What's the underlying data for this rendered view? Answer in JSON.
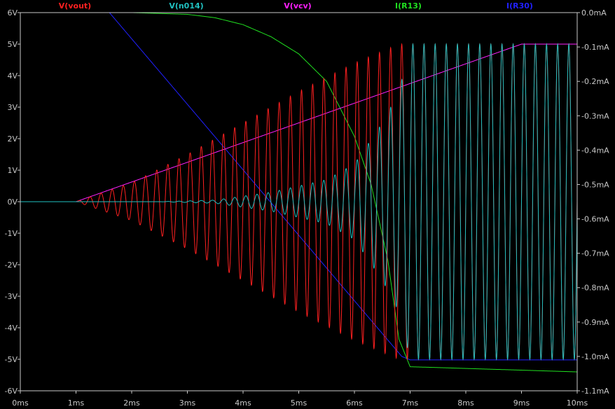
{
  "chart_data": {
    "type": "line",
    "title": "",
    "xlabel": "",
    "ylabel": "",
    "xlim": [
      0,
      10
    ],
    "ylim_left": [
      -6,
      6
    ],
    "ylim_right": [
      -1.1,
      0.0
    ],
    "grid": false,
    "legend_position": "top",
    "x_ticks": [
      "0ms",
      "1ms",
      "2ms",
      "3ms",
      "4ms",
      "5ms",
      "6ms",
      "7ms",
      "8ms",
      "9ms",
      "10ms"
    ],
    "y_ticks_left": [
      "6V",
      "5V",
      "4V",
      "3V",
      "2V",
      "1V",
      "0V",
      "-1V",
      "-2V",
      "-3V",
      "-4V",
      "-5V",
      "-6V"
    ],
    "y_ticks_right": [
      "0.0mA",
      "-0.1mA",
      "-0.2mA",
      "-0.3mA",
      "-0.4mA",
      "-0.5mA",
      "-0.6mA",
      "-0.7mA",
      "-0.8mA",
      "-0.9mA",
      "-1.0mA",
      "-1.1mA"
    ],
    "series": [
      {
        "name": "V(vout)",
        "color": "#ff2020",
        "axis": "left",
        "kind": "oscillation",
        "x": [
          0,
          1.0,
          2.0,
          3.0,
          4.0,
          5.0,
          6.0,
          6.8,
          7.5,
          8.5,
          9.5,
          10.0
        ],
        "envelope": [
          0.0,
          0.0,
          0.6,
          1.5,
          2.5,
          3.5,
          4.4,
          5.0,
          5.0,
          5.0,
          5.0,
          5.0
        ],
        "period_ms": 0.2
      },
      {
        "name": "V(n014)",
        "color": "#20c0c0",
        "axis": "left",
        "kind": "oscillation",
        "x": [
          0,
          2.5,
          3.5,
          4.5,
          5.5,
          6.0,
          6.5,
          6.8,
          7.0,
          8.0,
          9.0,
          10.0
        ],
        "envelope": [
          0.0,
          0.0,
          0.05,
          0.3,
          0.7,
          1.2,
          2.5,
          3.5,
          5.0,
          5.0,
          5.0,
          5.0
        ],
        "period_ms": 0.2
      },
      {
        "name": "V(vcv)",
        "color": "#ff20ff",
        "axis": "left",
        "x": [
          0,
          1.0,
          9.0,
          10.0
        ],
        "y": [
          0.0,
          0.0,
          5.0,
          5.0
        ]
      },
      {
        "name": "I(R13)",
        "color": "#20e020",
        "axis": "right",
        "x": [
          0,
          2.0,
          3.0,
          3.5,
          4.0,
          4.5,
          5.0,
          5.5,
          6.0,
          6.3,
          6.6,
          6.8,
          7.0,
          8.0,
          9.0,
          10.0
        ],
        "y": [
          0.0,
          0.0,
          -0.005,
          -0.015,
          -0.035,
          -0.07,
          -0.12,
          -0.2,
          -0.36,
          -0.5,
          -0.72,
          -0.95,
          -1.03,
          -1.035,
          -1.04,
          -1.045
        ]
      },
      {
        "name": "I(R30)",
        "color": "#2020ff",
        "axis": "right",
        "x": [
          0,
          1.6,
          6.85,
          7.0,
          10.0
        ],
        "y": [
          0.0,
          0.0,
          -1.0,
          -1.01,
          -1.01
        ]
      }
    ]
  }
}
